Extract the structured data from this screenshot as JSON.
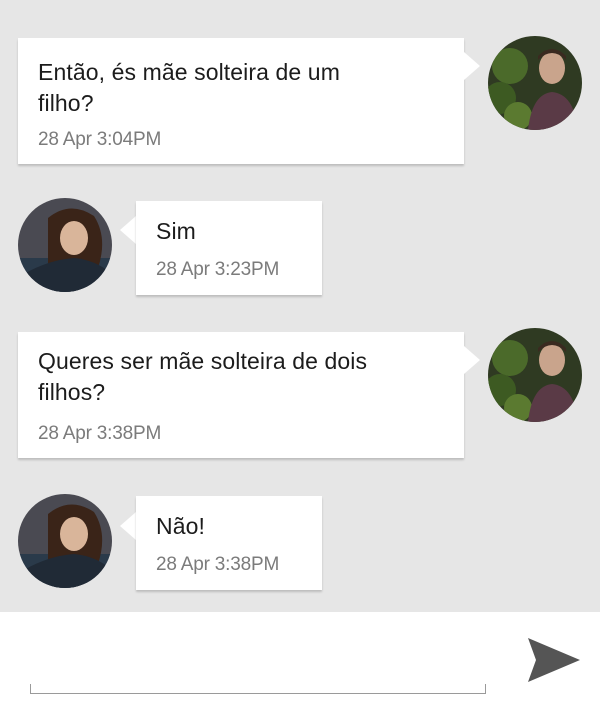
{
  "messages": [
    {
      "direction": "outgoing",
      "lines": [
        "Então, és mãe solteira de um",
        "filho?"
      ],
      "time": "28 Apr  3:04PM",
      "avatar": "male-user-avatar"
    },
    {
      "direction": "incoming",
      "lines": [
        "Sim"
      ],
      "time": "28 Apr  3:23PM",
      "avatar": "female-user-avatar"
    },
    {
      "direction": "outgoing",
      "lines": [
        "Queres ser mãe solteira de dois",
        "filhos?"
      ],
      "time": "28 Apr  3:38PM",
      "avatar": "male-user-avatar"
    },
    {
      "direction": "incoming",
      "lines": [
        "Não!"
      ],
      "time": "28 Apr  3:38PM",
      "avatar": "female-user-avatar"
    }
  ],
  "composer": {
    "placeholder": "",
    "send_icon": "send-icon"
  },
  "colors": {
    "background": "#e6e6e6",
    "bubble": "#ffffff",
    "text": "#1c1c1c",
    "time": "#7b7b7b",
    "send_icon": "#555555"
  }
}
